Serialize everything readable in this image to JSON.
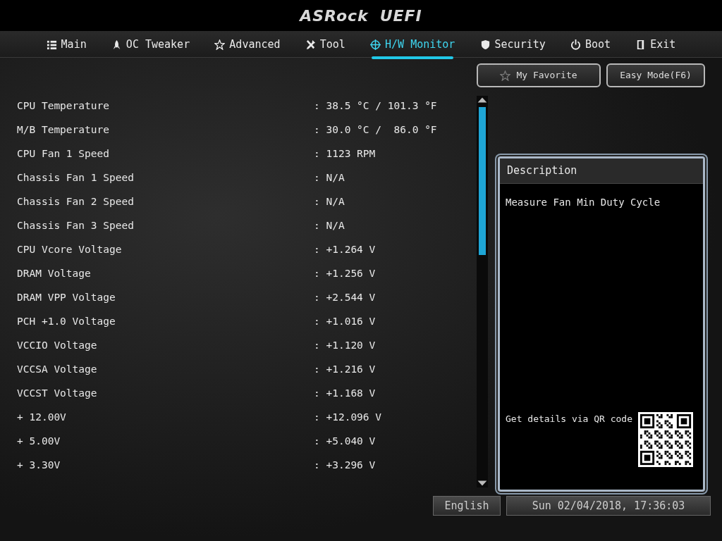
{
  "logo": {
    "brand": "ASRock",
    "product": "UEFI"
  },
  "tabs": [
    {
      "label": "Main",
      "selected": false
    },
    {
      "label": "OC Tweaker",
      "selected": false
    },
    {
      "label": "Advanced",
      "selected": false
    },
    {
      "label": "Tool",
      "selected": false
    },
    {
      "label": "H/W Monitor",
      "selected": true
    },
    {
      "label": "Security",
      "selected": false
    },
    {
      "label": "Boot",
      "selected": false
    },
    {
      "label": "Exit",
      "selected": false
    }
  ],
  "top_buttons": [
    {
      "label": "My Favorite"
    },
    {
      "label": "Easy Mode(F6)"
    }
  ],
  "readings": [
    {
      "label": "CPU Temperature",
      "value": ": 38.5 °C / 101.3 °F"
    },
    {
      "label": "M/B Temperature",
      "value": ": 30.0 °C /  86.0 °F"
    },
    {
      "label": "CPU Fan 1 Speed",
      "value": ": 1123 RPM"
    },
    {
      "label": "Chassis Fan 1 Speed",
      "value": ": N/A"
    },
    {
      "label": "Chassis Fan 2 Speed",
      "value": ": N/A"
    },
    {
      "label": "Chassis Fan 3 Speed",
      "value": ": N/A"
    },
    {
      "label": "CPU Vcore Voltage",
      "value": ": +1.264 V"
    },
    {
      "label": "DRAM Voltage",
      "value": ": +1.256 V"
    },
    {
      "label": "DRAM VPP Voltage",
      "value": ": +2.544 V"
    },
    {
      "label": "PCH +1.0 Voltage",
      "value": ": +1.016 V"
    },
    {
      "label": "VCCIO Voltage",
      "value": ": +1.120 V"
    },
    {
      "label": "VCCSA Voltage",
      "value": ": +1.216 V"
    },
    {
      "label": "VCCST Voltage",
      "value": ": +1.168 V"
    },
    {
      "label": "+ 12.00V",
      "value": ": +12.096 V"
    },
    {
      "label": "+ 5.00V",
      "value": ": +5.040 V"
    },
    {
      "label": "+ 3.30V",
      "value": ": +3.296 V"
    }
  ],
  "description": {
    "title": "Description",
    "text": "Measure Fan Min Duty Cycle",
    "qr_caption": "Get details via QR code"
  },
  "status_bar": {
    "language": "English",
    "datetime": "Sun 02/04/2018, 17:36:03"
  }
}
